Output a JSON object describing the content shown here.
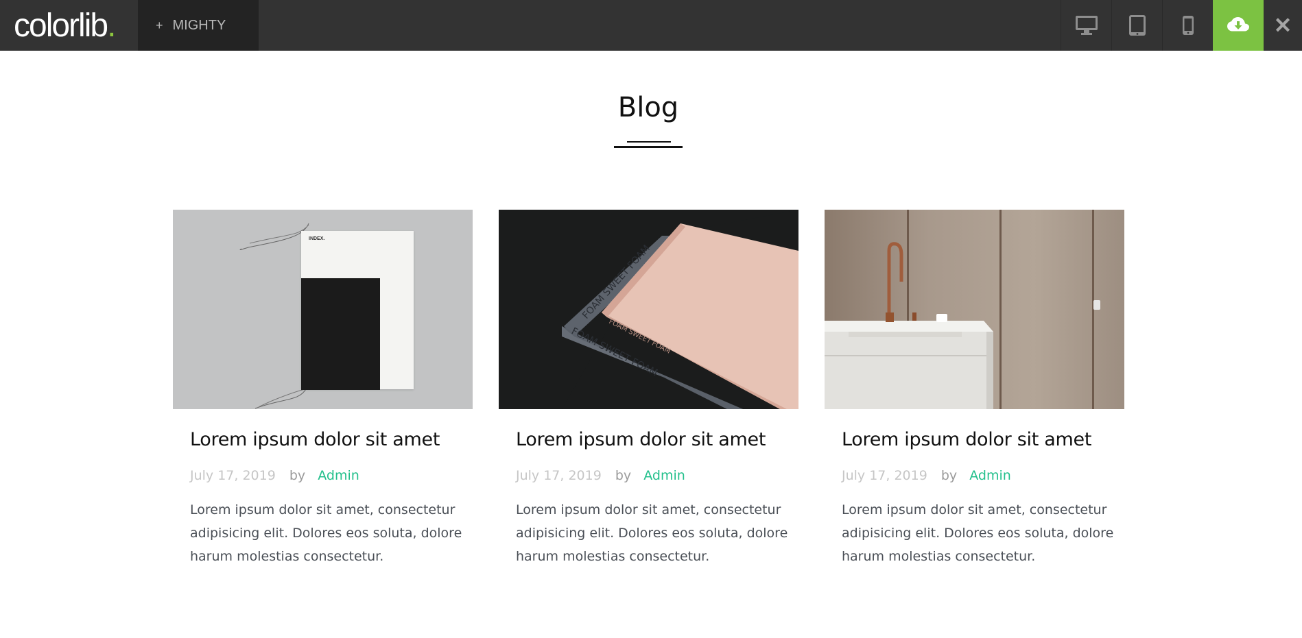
{
  "topbar": {
    "logo_text": "colorlib",
    "logo_dot": ".",
    "theme_label": "MIGHTY",
    "theme_plus": "+",
    "close_symbol": "✕",
    "colors": {
      "bar": "#333333",
      "download": "#7cc242",
      "logo_dot": "#8dc63f"
    },
    "devices": [
      "desktop-icon",
      "tablet-icon",
      "mobile-icon"
    ]
  },
  "section": {
    "title": "Blog"
  },
  "posts": [
    {
      "title": "Lorem ipsum dolor sit amet",
      "date": "July 17, 2019",
      "by": "by",
      "author": "Admin",
      "excerpt": "Lorem ipsum dolor sit amet, consectetur adipisicing elit. Dolores eos soluta, dolore harum molestias consectetur."
    },
    {
      "title": "Lorem ipsum dolor sit amet",
      "date": "July 17, 2019",
      "by": "by",
      "author": "Admin",
      "excerpt": "Lorem ipsum dolor sit amet, consectetur adipisicing elit. Dolores eos soluta, dolore harum molestias consectetur."
    },
    {
      "title": "Lorem ipsum dolor sit amet",
      "date": "July 17, 2019",
      "by": "by",
      "author": "Admin",
      "excerpt": "Lorem ipsum dolor sit amet, consectetur adipisicing elit. Dolores eos soluta, dolore harum molestias consectetur."
    }
  ],
  "images": {
    "img1_index_text": "INDEX.",
    "img2_book_text": "FOAM SWEET FOAM"
  }
}
